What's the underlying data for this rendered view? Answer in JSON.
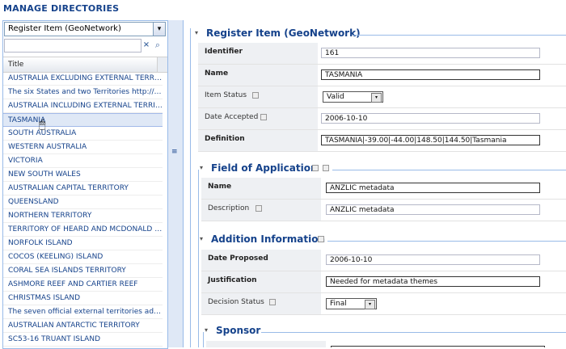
{
  "page_title": "MANAGE DIRECTORIES",
  "directory_combo": {
    "value": "Register Item (GeoNetwork)"
  },
  "search": {
    "value": "",
    "clear_icon": "×",
    "search_icon": "⌕"
  },
  "grid": {
    "column_title": "Title",
    "rows": [
      "AUSTRALIA EXCLUDING EXTERNAL TERRITORIES",
      "The six States and two Territories http://www.a...",
      "AUSTRALIA INCLUDING EXTERNAL TERRITORIES",
      "TASMANIA",
      "SOUTH AUSTRALIA",
      "WESTERN AUSTRALIA",
      "VICTORIA",
      "NEW SOUTH WALES",
      "AUSTRALIAN CAPITAL TERRITORY",
      "QUEENSLAND",
      "NORTHERN TERRITORY",
      "TERRITORY OF HEARD AND MCDONALD ISLANDS",
      "NORFOLK ISLAND",
      "COCOS (KEELING) ISLAND",
      "CORAL SEA ISLANDS TERRITORY",
      "ASHMORE REEF AND CARTIER REEF",
      "CHRISTMAS ISLAND",
      "The seven official external territories administe...",
      "AUSTRALIAN ANTARCTIC TERRITORY",
      "SC53-16 TRUANT ISLAND"
    ],
    "selected_index": 3
  },
  "register": {
    "title": "Register Item (GeoNetwork)",
    "identifier_label": "Identifier",
    "identifier_value": "161",
    "name_label": "Name",
    "name_value": "TASMANIA",
    "status_label": "Item Status",
    "status_value": "Valid",
    "date_label": "Date Accepted",
    "date_value": "2006-10-10",
    "definition_label": "Definition",
    "definition_value": "TASMANIA|-39.00|-44.00|148.50|144.50|Tasmania"
  },
  "field_of_application": {
    "title": "Field of Application",
    "name_label": "Name",
    "name_value": "ANZLIC metadata",
    "desc_label": "Description",
    "desc_value": "ANZLIC metadata"
  },
  "addition_information": {
    "title": "Addition Information",
    "date_label": "Date Proposed",
    "date_value": "2006-10-10",
    "just_label": "Justification",
    "just_value": "Needed for metadata themes",
    "decision_label": "Decision Status",
    "decision_value": "Final"
  },
  "sponsor": {
    "title": "Sponsor"
  },
  "icons": {
    "collapse": "▾",
    "dropdown": "▾",
    "splitter": "≡"
  }
}
